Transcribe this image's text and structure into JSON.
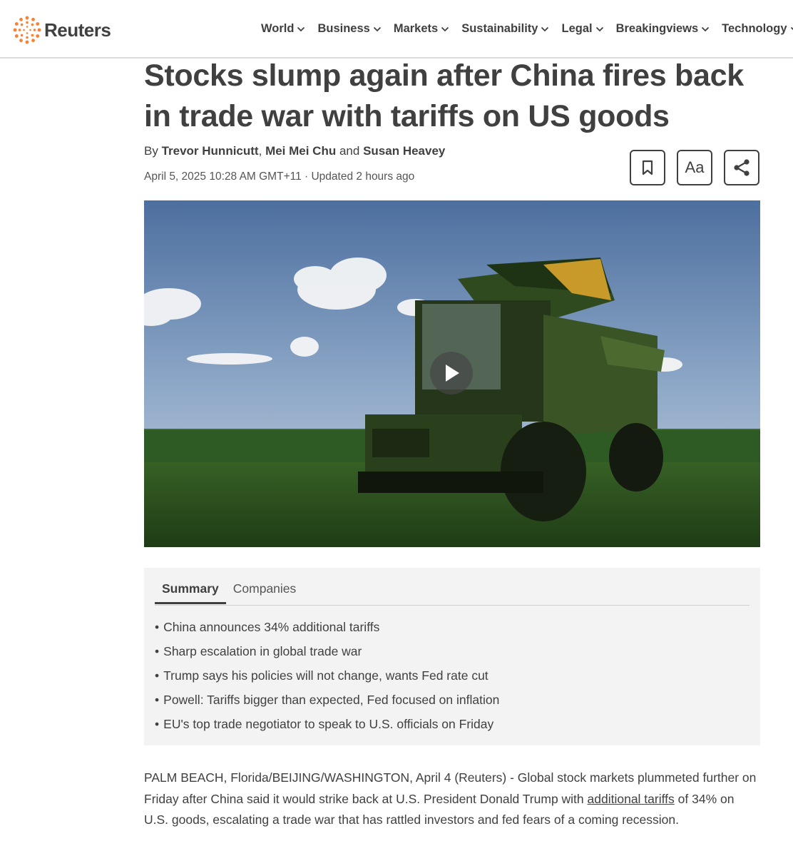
{
  "brand": {
    "name": "Reuters",
    "accent": "#fb8033"
  },
  "nav": [
    {
      "label": "World"
    },
    {
      "label": "Business"
    },
    {
      "label": "Markets"
    },
    {
      "label": "Sustainability"
    },
    {
      "label": "Legal"
    },
    {
      "label": "Breakingviews"
    },
    {
      "label": "Technology"
    }
  ],
  "article": {
    "headline_line1": "Stocks slump again after China fires back",
    "headline_line2": "in trade war with tariffs on US goods",
    "by": "By",
    "authors": [
      "Trevor Hunnicutt",
      "Mei Mei Chu",
      "Susan Heavey"
    ],
    "author_sep": ",",
    "author_and": "and",
    "date": "April 5, 2025 10:28 AM GMT+11 · Updated 2 hours ago",
    "tools": {
      "bookmark_icon": "bookmark-icon",
      "text_size_label": "Aa",
      "share_icon": "share-icon"
    }
  },
  "video": {
    "play_icon": "play-icon"
  },
  "summary": {
    "tabs": [
      "Summary",
      "Companies"
    ],
    "active_tab": "Summary",
    "bullets": [
      "China announces 34% additional tariffs",
      "Sharp escalation in global trade war",
      "Trump says his policies will not change, wants Fed rate cut",
      "Powell: Tariffs bigger than expected, Fed focused on inflation",
      "EU's top trade negotiator to speak to U.S. officials on Friday"
    ]
  },
  "body": {
    "p1_before": "PALM BEACH, Florida/BEIJING/WASHINGTON, April 4 (Reuters) - Global stock markets plummeted further on Friday after China said it would strike back at U.S. President Donald Trump with ",
    "p1_link": "additional tariffs",
    "p1_after": " of 34% on U.S. goods, escalating a trade war that has rattled investors and fed fears of a coming recession."
  }
}
